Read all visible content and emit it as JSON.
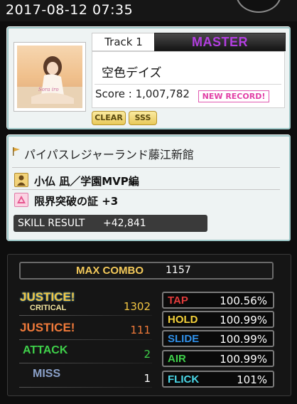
{
  "datetime": "2017-08-12 07:35",
  "song": {
    "track_label": "Track 1",
    "difficulty": "MASTER",
    "title": "空色デイズ",
    "score_text": "Score : 1,007,782",
    "new_record": "NEW RECORD!",
    "badges": [
      "CLEAR",
      "SSS"
    ]
  },
  "map": {
    "name": "パイパスレジャーランド藤江新館"
  },
  "character": "小仏 凪／学園MVP編",
  "skill": "限界突破の証 +3",
  "skill_result": {
    "label": "SKILL RESULT",
    "value": "+42,841"
  },
  "max_combo": {
    "label": "MAX COMBO",
    "value": "1157"
  },
  "judgements": [
    {
      "label": "JUSTICE!",
      "sub": "CRITICAL",
      "value": "1302",
      "color": "#f2c542"
    },
    {
      "label": "JUSTICE!",
      "sub": "",
      "value": "111",
      "color": "#f07a3a"
    },
    {
      "label": "ATTACK",
      "sub": "",
      "value": "2",
      "color": "#3fd04a"
    },
    {
      "label": "MISS",
      "sub": "",
      "value": "1",
      "color": "#8aa0c8"
    }
  ],
  "rates": [
    {
      "label": "TAP",
      "value": "100.56%",
      "color": "#e23b3b"
    },
    {
      "label": "HOLD",
      "value": "100.99%",
      "color": "#f4d13a"
    },
    {
      "label": "SLIDE",
      "value": "100.99%",
      "color": "#2f8fe8"
    },
    {
      "label": "AIR",
      "value": "100.99%",
      "color": "#3fd04a"
    },
    {
      "label": "FLICK",
      "value": "101%",
      "color": "#4ad8e8"
    }
  ]
}
